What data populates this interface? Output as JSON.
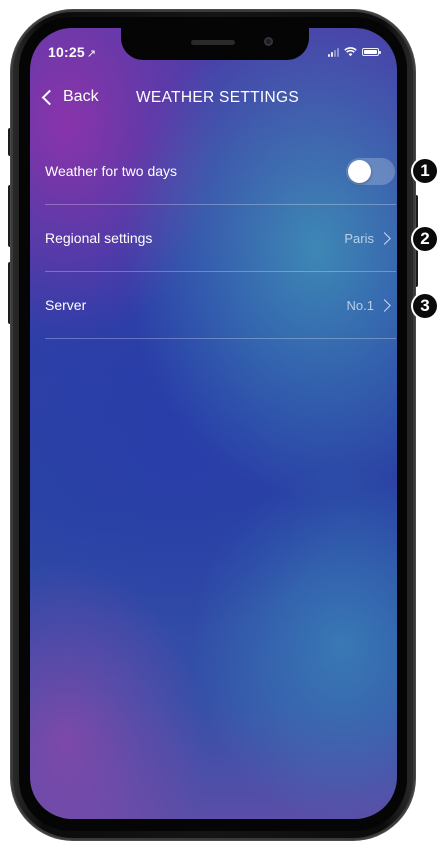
{
  "status_bar": {
    "time": "10:25",
    "location_glyph": "↗"
  },
  "nav": {
    "back_label": "Back",
    "title": "WEATHER SETTINGS"
  },
  "settings": [
    {
      "label": "Weather for two days",
      "type": "toggle",
      "enabled": false
    },
    {
      "label": "Regional settings",
      "type": "link",
      "value": "Paris"
    },
    {
      "label": "Server",
      "type": "link",
      "value": "No.1"
    }
  ],
  "callouts": [
    "1",
    "2",
    "3"
  ],
  "colors": {
    "screen_purple": "#4a3ea8",
    "screen_blue": "#2f3fa8",
    "screen_teal": "#40a0b9",
    "text": "#ffffff"
  }
}
